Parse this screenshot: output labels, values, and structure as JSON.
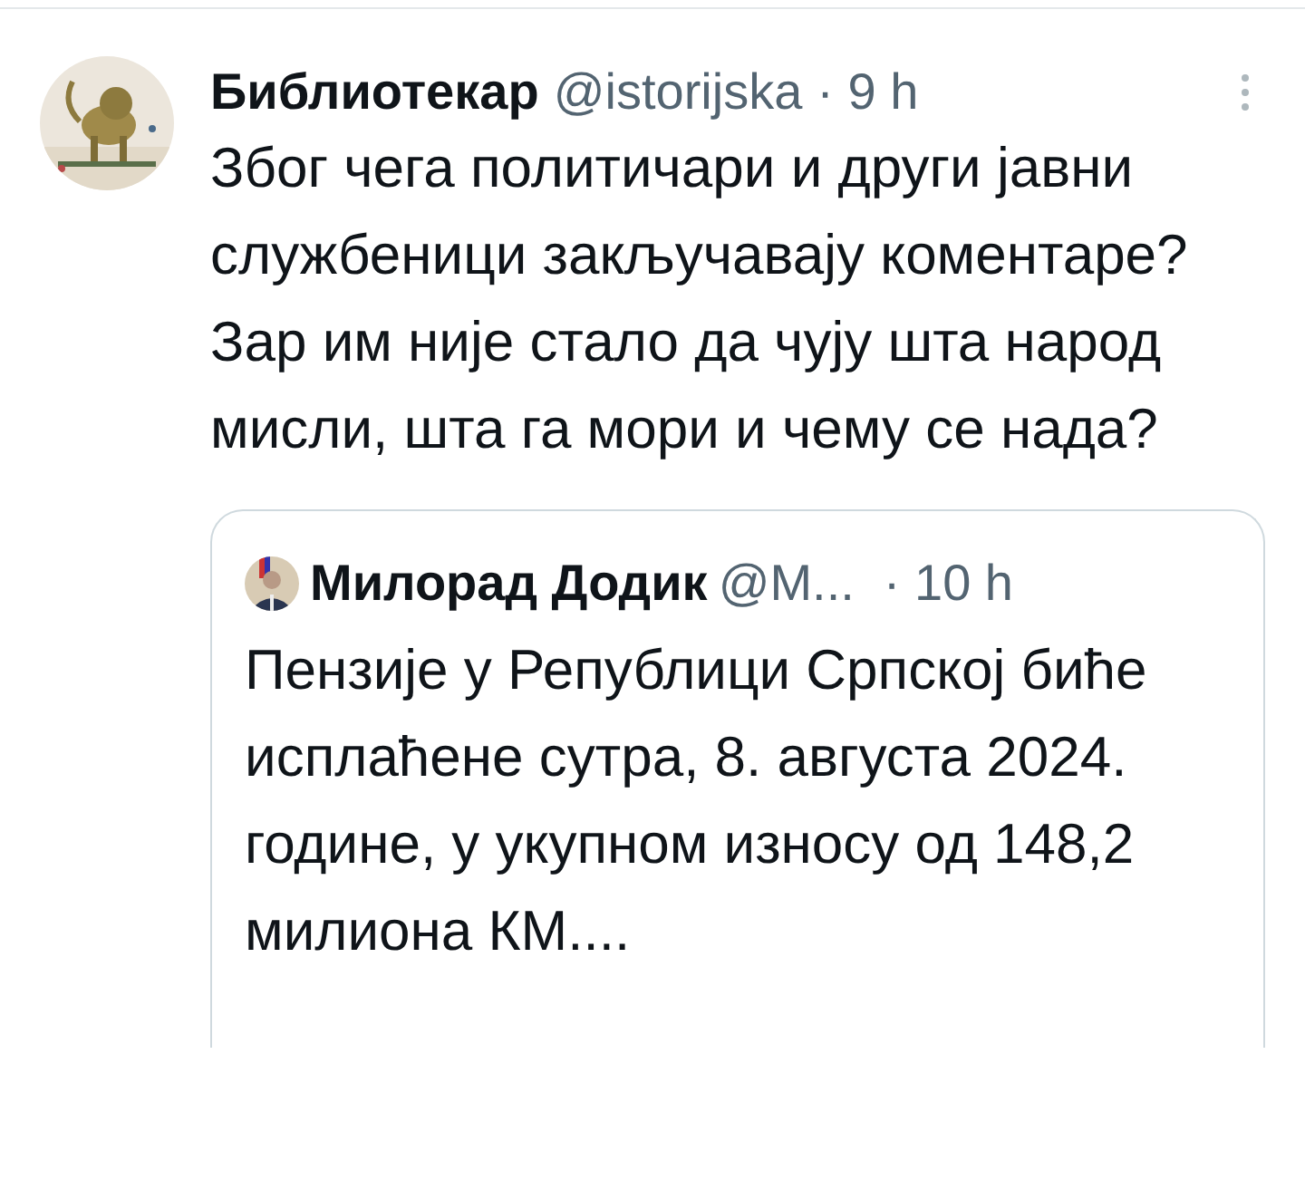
{
  "tweet": {
    "author": {
      "name": "Библиотекар",
      "handle": "@istorijska",
      "time": "· 9 h"
    },
    "text": "Због чега политичари и други јавни службеници закључавају коментаре? Зар им није стало да чују шта народ мисли, шта га мори и чему се нада?",
    "quoted": {
      "author": {
        "name": "Милорад Додик",
        "handle": "@M...",
        "time": "· 10 h"
      },
      "text": "Пензије у Републици Српској биће исплаћене сутра, 8. августа 2024. године, у укупном износу од 148,2 милиона КМ...."
    }
  }
}
